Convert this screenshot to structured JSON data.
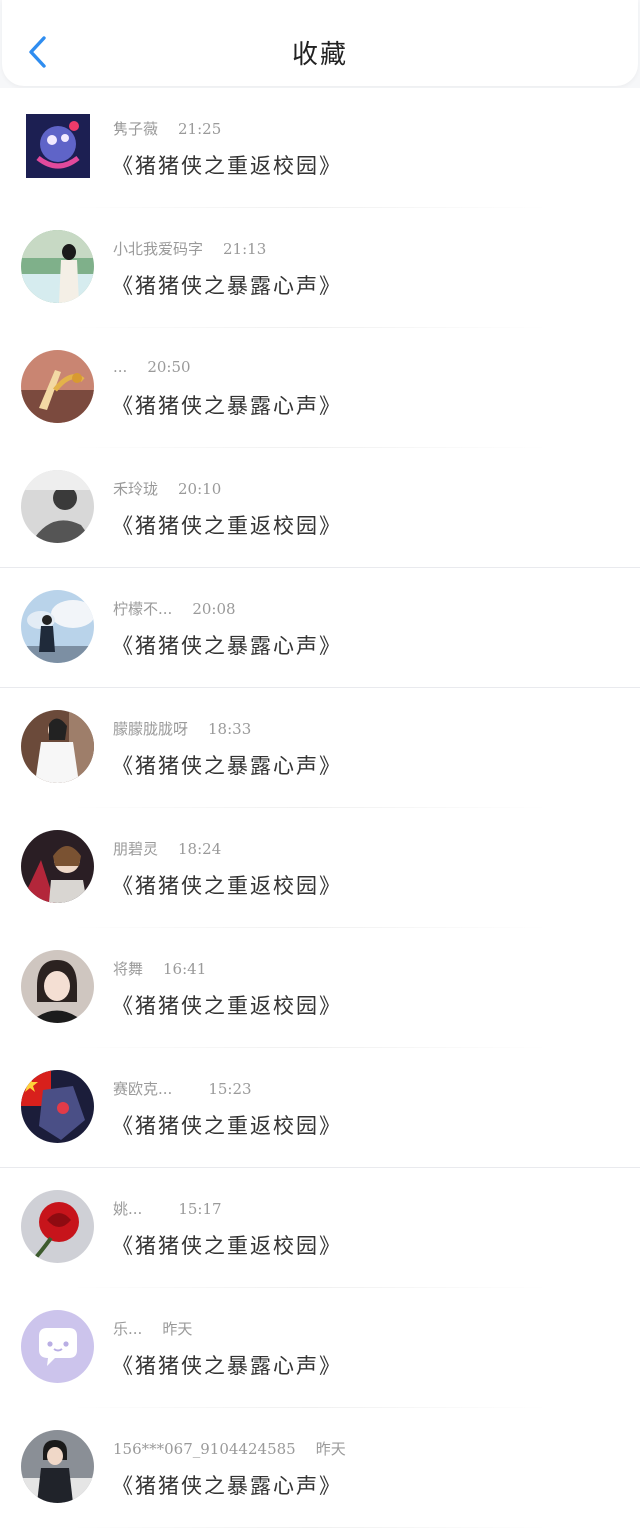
{
  "header": {
    "title": "收藏"
  },
  "items": [
    {
      "name": "隽子薇",
      "time": "21:25",
      "book": "《猪猪侠之重返校园》"
    },
    {
      "name": "小北我爱码字",
      "time": "21:13",
      "book": "《猪猪侠之暴露心声》"
    },
    {
      "name": "...",
      "time": "20:50",
      "book": "《猪猪侠之暴露心声》"
    },
    {
      "name": "禾玲珑",
      "time": "20:10",
      "book": "《猪猪侠之重返校园》"
    },
    {
      "name": "柠檬不...",
      "time": "20:08",
      "book": "《猪猪侠之暴露心声》"
    },
    {
      "name": "朦朦胧胧呀",
      "time": "18:33",
      "book": "《猪猪侠之暴露心声》"
    },
    {
      "name": "朋碧灵",
      "time": "18:24",
      "book": "《猪猪侠之重返校园》"
    },
    {
      "name": "将舞",
      "time": "16:41",
      "book": "《猪猪侠之重返校园》"
    },
    {
      "name": "赛欧克...",
      "time": "15:23",
      "book": "《猪猪侠之重返校园》"
    },
    {
      "name": "姚...",
      "time": "15:17",
      "book": "《猪猪侠之重返校园》"
    },
    {
      "name": "乐...",
      "time": "昨天",
      "book": "《猪猪侠之暴露心声》"
    },
    {
      "name": "156***067_9104424585",
      "time": "昨天",
      "book": "《猪猪侠之暴露心声》"
    }
  ],
  "colors": {
    "accent": "#2f8df0",
    "background": "#f6f7f9"
  }
}
